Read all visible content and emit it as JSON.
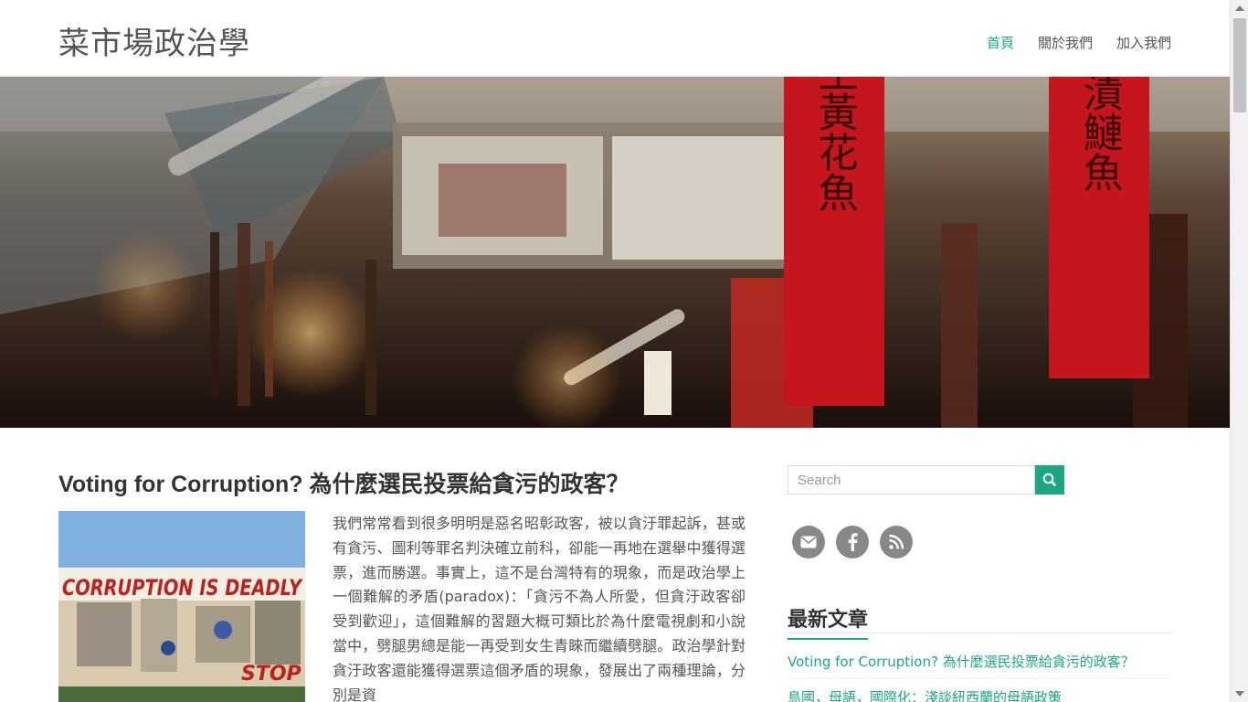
{
  "site": {
    "title": "菜市場政治學"
  },
  "nav": {
    "items": [
      {
        "label": "首頁",
        "active": true
      },
      {
        "label": "關於我們",
        "active": false
      },
      {
        "label": "加入我們",
        "active": false
      }
    ]
  },
  "hero": {
    "banners": [
      "生黃花魚",
      "漬鰱魚"
    ]
  },
  "post": {
    "title": "Voting for Corruption? 為什麼選民投票給貪污的政客？",
    "thumbnail": {
      "sign_text": "CORRUPTION IS DEADLY",
      "stop_text": "STOP"
    },
    "excerpt": "我們常常看到很多明明是惡名昭彰政客，被以貪汙罪起訴，甚或有貪污、圖利等罪名判決確立前科，卻能一再地在選舉中獲得選票，進而勝選。事實上，這不是台灣特有的現象，而是政治學上一個難解的矛盾(paradox)：「貪污不為人所愛，但貪汙政客卻受到歡迎」，這個難解的習題大概可類比於為什麼電視劇和小說當中，劈腿男總是能一再受到女生青睞而繼續劈腿。政治學針對貪汙政客還能獲得選票這個矛盾的現象，發展出了兩種理論，分別是資"
  },
  "sidebar": {
    "search": {
      "placeholder": "Search",
      "value": ""
    },
    "social": [
      {
        "icon": "email-icon",
        "glyph": "✉"
      },
      {
        "icon": "facebook-icon",
        "glyph": "f"
      },
      {
        "icon": "rss-icon",
        "glyph": "rss"
      }
    ],
    "recent": {
      "title": "最新文章",
      "items": [
        "Voting for Corruption? 為什麼選民投票給貪污的政客？",
        "島國，母語，國際化：淺談紐西蘭的母語政策"
      ]
    }
  },
  "colors": {
    "accent": "#1aa883",
    "icon_gray": "#888888"
  }
}
